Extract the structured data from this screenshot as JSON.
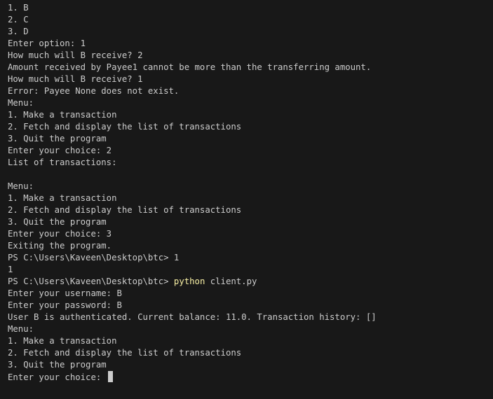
{
  "terminal": {
    "lines": [
      "1. B",
      "2. C",
      "3. D",
      "Enter option: 1",
      "How much will B receive? 2",
      "Amount received by Payee1 cannot be more than the transferring amount.",
      "How much will B receive? 1",
      "Error: Payee None does not exist.",
      "Menu:",
      "1. Make a transaction",
      "2. Fetch and display the list of transactions",
      "3. Quit the program",
      "Enter your choice: 2",
      "List of transactions:",
      "",
      "Menu:",
      "1. Make a transaction",
      "2. Fetch and display the list of transactions",
      "3. Quit the program",
      "Enter your choice: 3",
      "Exiting the program.",
      "PS C:\\Users\\Kaveen\\Desktop\\btc> 1",
      "1"
    ],
    "command_prompt": "PS C:\\Users\\Kaveen\\Desktop\\btc> ",
    "command_name": "python",
    "command_args": " client.py",
    "lines_after": [
      "Enter your username: B",
      "Enter your password: B",
      "User B is authenticated. Current balance: 11.0. Transaction history: []",
      "Menu:",
      "1. Make a transaction",
      "2. Fetch and display the list of transactions",
      "3. Quit the program"
    ],
    "input_prompt": "Enter your choice: ",
    "colors": {
      "background": "#181818",
      "text": "#cccccc",
      "command": "#f9f1a5"
    }
  }
}
